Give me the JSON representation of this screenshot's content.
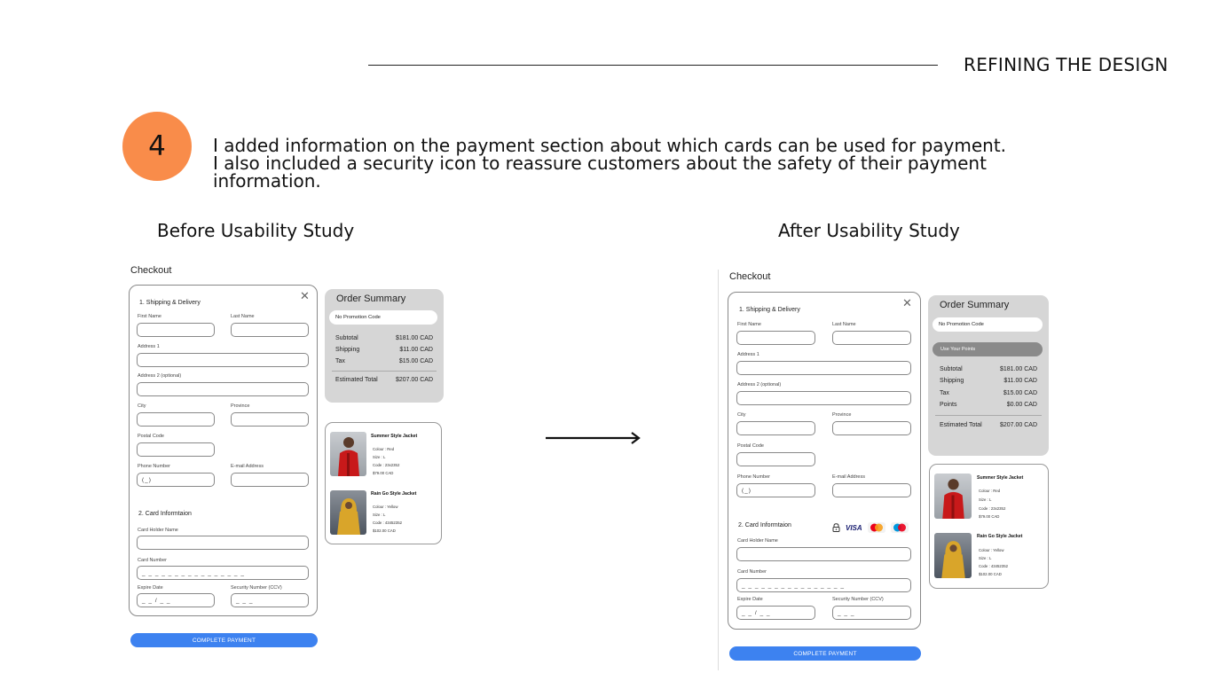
{
  "header": {
    "title": "REFINING THE DESIGN"
  },
  "step": {
    "number": "4",
    "description_lines": [
      "I added information on the payment section about which cards can be used for payment.",
      "I also included a security icon to reassure customers about the safety of their payment",
      "information."
    ]
  },
  "before": {
    "title": "Before Usability Study"
  },
  "after": {
    "title": "After Usability Study"
  },
  "colors": {
    "accent_circle": "#F98C4A",
    "pay_button": "#3D82F0",
    "summary_bg": "#D6D6D6"
  },
  "checkout": {
    "title": "Checkout",
    "close_icon": "close-icon",
    "shipping_title": "1. Shipping & Delivery",
    "first_name": "First Name",
    "last_name": "Last Name",
    "address1": "Address 1",
    "address2": "Address 2 (optional)",
    "city": "City",
    "province": "Province",
    "postal_code": "Postal Code",
    "phone": "Phone Number",
    "phone_value": "(_)",
    "email": "E-mail Address",
    "card_title": "2. Card Informtaion",
    "card_holder": "Card Holder Name",
    "card_number": "Card Number",
    "card_number_value": "_ _ _ _    _ _ _ _    _ _ _ _    _ _ _ _",
    "expire": "Expire Date",
    "expire_value": "_ _ / _ _",
    "security": "Security Number (CCV)",
    "security_value": "_ _ _",
    "pay_button": "COMPLETE PAYMENT"
  },
  "summary": {
    "title": "Order Summary",
    "promo": "No Promotion Code",
    "use_points": "Use Your Points",
    "subtotal_label": "Subtotal",
    "subtotal": "$181.00 CAD",
    "shipping_label": "Shipping",
    "shipping": "$11.00 CAD",
    "tax_label": "Tax",
    "tax": "$15.00 CAD",
    "points_label": "Points",
    "points": "$0.00 CAD",
    "total_label": "Estimated Total",
    "total": "$207.00 CAD"
  },
  "items": [
    {
      "name": "Summer Style Jacket",
      "colour": "Colour : Red",
      "size": "Size     : L",
      "code": "Code   : 23x2352",
      "price": "$79.00 CAD"
    },
    {
      "name": "Rain Go Style Jacket",
      "colour": "Colour : Yellow",
      "size": "Size     : L",
      "code": "Code   : 43452352",
      "price": "$102.00 CAD"
    }
  ],
  "payment_icons": {
    "lock": "lock-icon",
    "visa": "VISA",
    "mastercard": "mastercard-icon",
    "maestro": "maestro-icon"
  }
}
